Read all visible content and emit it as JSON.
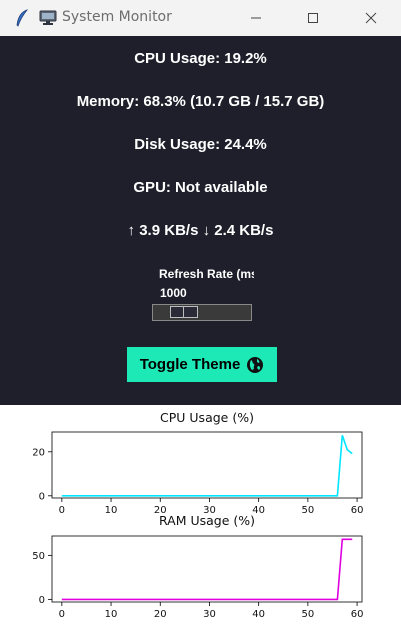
{
  "window": {
    "title": "System Monitor"
  },
  "stats": {
    "cpu": "CPU Usage: 19.2%",
    "memory": "Memory: 68.3% (10.7 GB / 15.7 GB)",
    "disk": "Disk Usage: 24.4%",
    "gpu": "GPU: Not available",
    "network": "↑ 3.9 KB/s ↓ 2.4 KB/s"
  },
  "refresh": {
    "label": "Refresh Rate (ms)",
    "value": "1000",
    "min": 100,
    "max": 5000
  },
  "toggle_button": {
    "label": "Toggle Theme"
  },
  "colors": {
    "panel_bg": "#1f1f2b",
    "accent": "#1de9b6",
    "cpu_line": "#00e5ff",
    "ram_line": "#e000e0"
  },
  "chart_data": [
    {
      "type": "line",
      "title": "CPU Usage (%)",
      "xlim": [
        -2,
        61
      ],
      "ylim": [
        -1,
        29
      ],
      "x_ticks": [
        0,
        10,
        20,
        30,
        40,
        50,
        60
      ],
      "y_ticks": [
        0,
        20
      ],
      "series": [
        {
          "color": "#00e5ff",
          "x": [
            0,
            1,
            2,
            3,
            4,
            5,
            6,
            7,
            8,
            9,
            10,
            11,
            12,
            13,
            14,
            15,
            16,
            17,
            18,
            19,
            20,
            21,
            22,
            23,
            24,
            25,
            26,
            27,
            28,
            29,
            30,
            31,
            32,
            33,
            34,
            35,
            36,
            37,
            38,
            39,
            40,
            41,
            42,
            43,
            44,
            45,
            46,
            47,
            48,
            49,
            50,
            51,
            52,
            53,
            54,
            55,
            56,
            57,
            58,
            59
          ],
          "y": [
            0,
            0,
            0,
            0,
            0,
            0,
            0,
            0,
            0,
            0,
            0,
            0,
            0,
            0,
            0,
            0,
            0,
            0,
            0,
            0,
            0,
            0,
            0,
            0,
            0,
            0,
            0,
            0,
            0,
            0,
            0,
            0,
            0,
            0,
            0,
            0,
            0,
            0,
            0,
            0,
            0,
            0,
            0,
            0,
            0,
            0,
            0,
            0,
            0,
            0,
            0,
            0,
            0,
            0,
            0,
            0,
            0,
            27.5,
            21,
            19.2
          ]
        }
      ]
    },
    {
      "type": "line",
      "title": "RAM Usage (%)",
      "xlim": [
        -2,
        61
      ],
      "ylim": [
        -3,
        72
      ],
      "x_ticks": [
        0,
        10,
        20,
        30,
        40,
        50,
        60
      ],
      "y_ticks": [
        0,
        50
      ],
      "series": [
        {
          "color": "#e000e0",
          "x": [
            0,
            1,
            2,
            3,
            4,
            5,
            6,
            7,
            8,
            9,
            10,
            11,
            12,
            13,
            14,
            15,
            16,
            17,
            18,
            19,
            20,
            21,
            22,
            23,
            24,
            25,
            26,
            27,
            28,
            29,
            30,
            31,
            32,
            33,
            34,
            35,
            36,
            37,
            38,
            39,
            40,
            41,
            42,
            43,
            44,
            45,
            46,
            47,
            48,
            49,
            50,
            51,
            52,
            53,
            54,
            55,
            56,
            57,
            58,
            59
          ],
          "y": [
            0,
            0,
            0,
            0,
            0,
            0,
            0,
            0,
            0,
            0,
            0,
            0,
            0,
            0,
            0,
            0,
            0,
            0,
            0,
            0,
            0,
            0,
            0,
            0,
            0,
            0,
            0,
            0,
            0,
            0,
            0,
            0,
            0,
            0,
            0,
            0,
            0,
            0,
            0,
            0,
            0,
            0,
            0,
            0,
            0,
            0,
            0,
            0,
            0,
            0,
            0,
            0,
            0,
            0,
            0,
            0,
            0,
            68.3,
            68.3,
            68.3
          ]
        }
      ]
    }
  ]
}
